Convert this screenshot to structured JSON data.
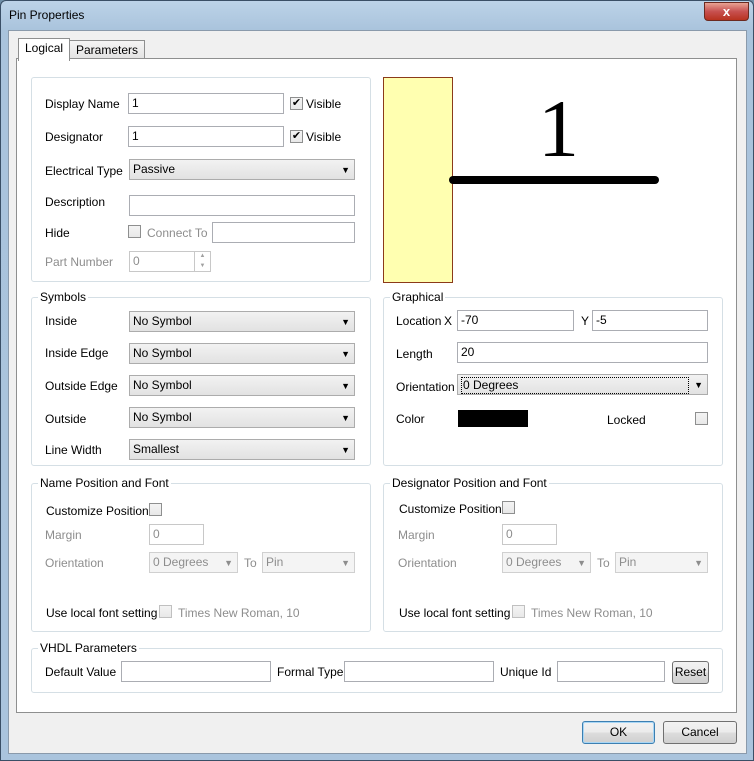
{
  "window": {
    "title": "Pin Properties",
    "close_symbol": "x"
  },
  "tabs": [
    {
      "label": "Logical"
    },
    {
      "label": "Parameters"
    }
  ],
  "logical": {
    "display_name": {
      "label": "Display Name",
      "value": "1",
      "visible_label": "Visible",
      "visible_checked": true
    },
    "designator": {
      "label": "Designator",
      "value": "1",
      "visible_label": "Visible",
      "visible_checked": true
    },
    "electrical_type": {
      "label": "Electrical Type",
      "value": "Passive"
    },
    "description": {
      "label": "Description",
      "value": ""
    },
    "hide": {
      "label": "Hide",
      "checked": false,
      "connect_to_label": "Connect To",
      "connect_to_value": ""
    },
    "part_number": {
      "label": "Part Number",
      "value": "0"
    }
  },
  "preview": {
    "pin_number": "1",
    "body_color": "#ffffb0"
  },
  "symbols": {
    "title": "Symbols",
    "inside": {
      "label": "Inside",
      "value": "No Symbol"
    },
    "inside_edge": {
      "label": "Inside Edge",
      "value": "No Symbol"
    },
    "outside_edge": {
      "label": "Outside Edge",
      "value": "No Symbol"
    },
    "outside": {
      "label": "Outside",
      "value": "No Symbol"
    },
    "line_width": {
      "label": "Line Width",
      "value": "Smallest"
    }
  },
  "graphical": {
    "title": "Graphical",
    "location_label": "Location",
    "x_label": "X",
    "x_value": "-70",
    "y_label": "Y",
    "y_value": "-5",
    "length_label": "Length",
    "length_value": "20",
    "orientation_label": "Orientation",
    "orientation_value": "0 Degrees",
    "color_label": "Color",
    "color_value": "#000000",
    "locked_label": "Locked",
    "locked_checked": false
  },
  "name_position": {
    "title": "Name Position and Font",
    "customize_label": "Customize Position",
    "margin_label": "Margin",
    "margin_value": "0",
    "orientation_label": "Orientation",
    "orientation_value": "0 Degrees",
    "to_label": "To",
    "to_value": "Pin",
    "font_label": "Use local font setting",
    "font_value": "Times New Roman, 10"
  },
  "designator_position": {
    "title": "Designator Position and Font",
    "customize_label": "Customize Position",
    "margin_label": "Margin",
    "margin_value": "0",
    "orientation_label": "Orientation",
    "orientation_value": "0 Degrees",
    "to_label": "To",
    "to_value": "Pin",
    "font_label": "Use local font setting",
    "font_value": "Times New Roman, 10"
  },
  "vhdl": {
    "title": "VHDL Parameters",
    "default_value_label": "Default Value",
    "default_value": "",
    "formal_type_label": "Formal Type",
    "formal_type": "",
    "unique_id_label": "Unique Id",
    "unique_id": "",
    "reset_label": "Reset"
  },
  "footer": {
    "ok_label": "OK",
    "cancel_label": "Cancel"
  }
}
